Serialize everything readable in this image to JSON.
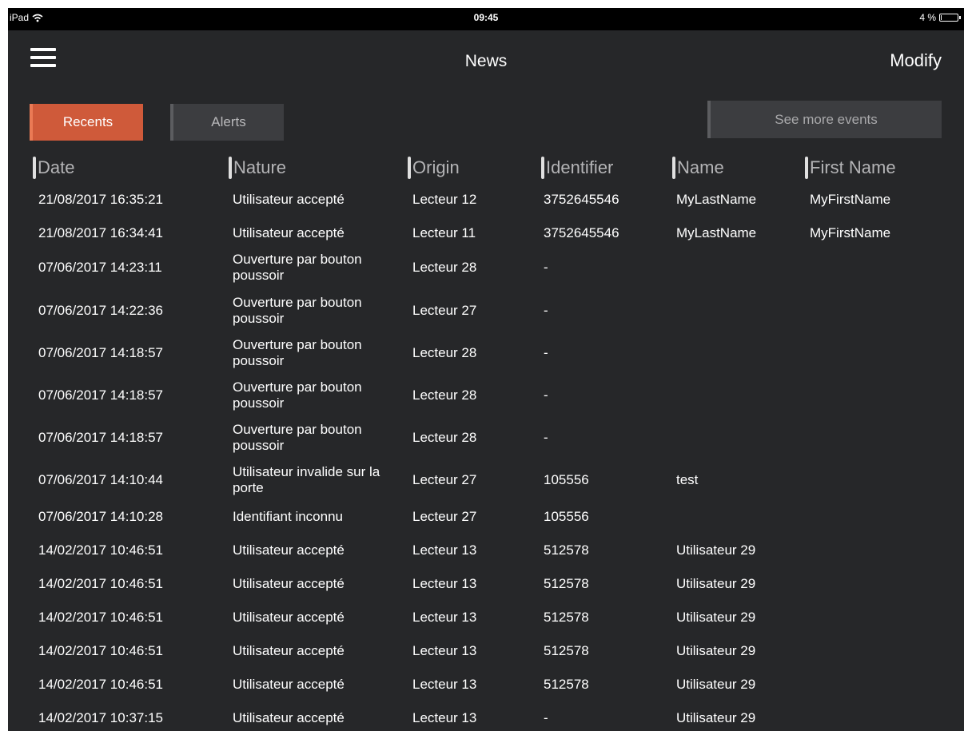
{
  "status_bar": {
    "device": "iPad",
    "time": "09:45",
    "battery": "4 %"
  },
  "nav": {
    "title": "News",
    "modify_label": "Modify"
  },
  "tabs": [
    {
      "label": "Recents",
      "active": true
    },
    {
      "label": "Alerts",
      "active": false
    }
  ],
  "see_more_label": "See more events",
  "columns": [
    "Date",
    "Nature",
    "Origin",
    "Identifier",
    "Name",
    "First Name"
  ],
  "rows": [
    {
      "date": "21/08/2017 16:35:21",
      "nature": "Utilisateur accepté",
      "origin": "Lecteur 12",
      "identifier": "3752645546",
      "name": "MyLastName",
      "first_name": "MyFirstName"
    },
    {
      "date": "21/08/2017 16:34:41",
      "nature": "Utilisateur accepté",
      "origin": "Lecteur 11",
      "identifier": "3752645546",
      "name": "MyLastName",
      "first_name": "MyFirstName"
    },
    {
      "date": "07/06/2017 14:23:11",
      "nature": "Ouverture par bouton poussoir",
      "origin": "Lecteur 28",
      "identifier": "-",
      "name": "",
      "first_name": ""
    },
    {
      "date": "07/06/2017 14:22:36",
      "nature": "Ouverture par bouton poussoir",
      "origin": "Lecteur 27",
      "identifier": "-",
      "name": "",
      "first_name": ""
    },
    {
      "date": "07/06/2017 14:18:57",
      "nature": "Ouverture par bouton poussoir",
      "origin": "Lecteur 28",
      "identifier": "-",
      "name": "",
      "first_name": ""
    },
    {
      "date": "07/06/2017 14:18:57",
      "nature": "Ouverture par bouton poussoir",
      "origin": "Lecteur 28",
      "identifier": "-",
      "name": "",
      "first_name": ""
    },
    {
      "date": "07/06/2017 14:18:57",
      "nature": "Ouverture par bouton poussoir",
      "origin": "Lecteur 28",
      "identifier": "-",
      "name": "",
      "first_name": ""
    },
    {
      "date": "07/06/2017 14:10:44",
      "nature": "Utilisateur invalide sur la porte",
      "origin": "Lecteur 27",
      "identifier": "105556",
      "name": "test",
      "first_name": ""
    },
    {
      "date": "07/06/2017 14:10:28",
      "nature": "Identifiant inconnu",
      "origin": "Lecteur 27",
      "identifier": "105556",
      "name": "",
      "first_name": ""
    },
    {
      "date": "14/02/2017 10:46:51",
      "nature": "Utilisateur accepté",
      "origin": "Lecteur 13",
      "identifier": "512578",
      "name": "Utilisateur 29",
      "first_name": ""
    },
    {
      "date": "14/02/2017 10:46:51",
      "nature": "Utilisateur accepté",
      "origin": "Lecteur 13",
      "identifier": "512578",
      "name": "Utilisateur 29",
      "first_name": ""
    },
    {
      "date": "14/02/2017 10:46:51",
      "nature": "Utilisateur accepté",
      "origin": "Lecteur 13",
      "identifier": "512578",
      "name": "Utilisateur 29",
      "first_name": ""
    },
    {
      "date": "14/02/2017 10:46:51",
      "nature": "Utilisateur accepté",
      "origin": "Lecteur 13",
      "identifier": "512578",
      "name": "Utilisateur 29",
      "first_name": ""
    },
    {
      "date": "14/02/2017 10:46:51",
      "nature": "Utilisateur accepté",
      "origin": "Lecteur 13",
      "identifier": "512578",
      "name": "Utilisateur 29",
      "first_name": ""
    },
    {
      "date": "14/02/2017 10:37:15",
      "nature": "Utilisateur accepté",
      "origin": "Lecteur 13",
      "identifier": "-",
      "name": "Utilisateur 29",
      "first_name": ""
    }
  ],
  "colors": {
    "background": "#262729",
    "accent": "#cf5a3a",
    "tab_inactive": "#3c3d40"
  },
  "icons": {
    "menu": "hamburger-menu-icon",
    "wifi": "wifi-icon",
    "battery": "battery-icon"
  }
}
